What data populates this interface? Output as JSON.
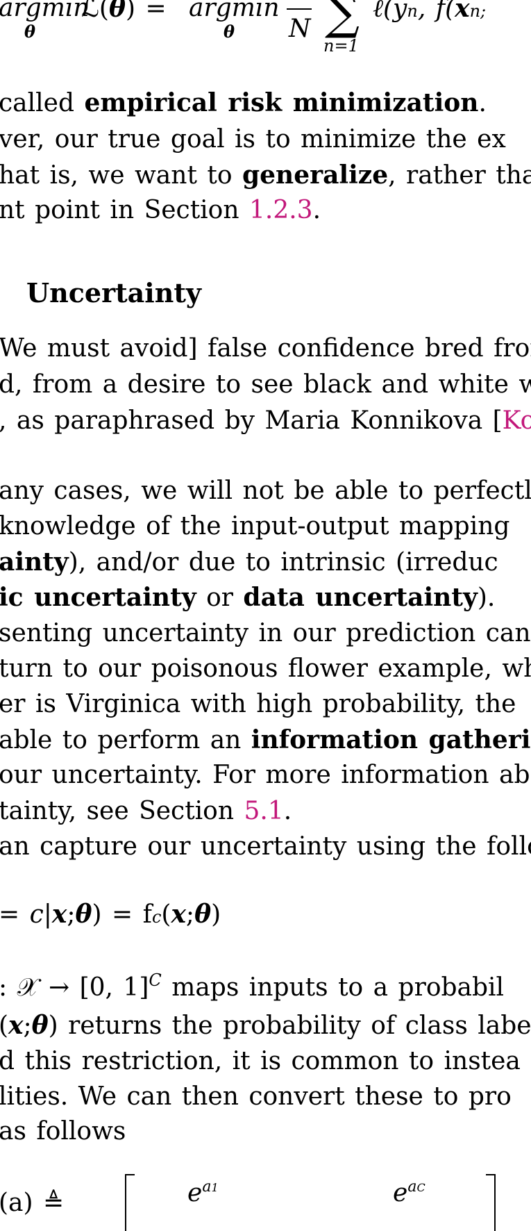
{
  "eq1": {
    "lhs": "argmin",
    "loss": "ℒ(",
    "theta": "θ",
    "eq": ") = ",
    "argmin2": "argmin",
    "N": "N",
    "sum": "∑",
    "n_eq_1": "n=1",
    "ell": "ℓ(y",
    "n": "n",
    "comma": ", f(",
    "x": "x",
    "semi": "n;"
  },
  "p1": {
    "l1_pre": "called ",
    "l1_bold": "empirical risk minimization",
    "l1_post": ".",
    "l2": "ver, our true goal is to minimize the ex",
    "l3_pre": "hat is, we want to ",
    "l3_bold": "generalize",
    "l3_post": ", rather tha",
    "l4_pre": "nt point in Section ",
    "l4_link": "1.2.3",
    "l4_post": "."
  },
  "section": {
    "title": "Uncertainty"
  },
  "quote": {
    "l1": "We must avoid] false confidence bred from",
    "l2": "d, from a desire to see black and white w",
    "l3_pre": ", as paraphrased by Maria Konnikova [",
    "l3_link": "Ko"
  },
  "p2": {
    "l1": "any cases, we will not be able to perfectly",
    "l2": "knowledge of the input-output mapping",
    "l3_bold": "ainty",
    "l3_post": "), and/or due to intrinsic (irreduc",
    "l4_bold1": "ic uncertainty",
    "l4_mid": " or ",
    "l4_bold2": "data uncertainty",
    "l4_post": ").",
    "l5": "senting uncertainty in our prediction can",
    "l6": "turn to our poisonous flower example, wh",
    "l7": "er is Virginica with high probability, the",
    "l8_pre": "able to perform an ",
    "l8_bold": "information gatheri",
    "l9": "our uncertainty. For more information abo",
    "l10_pre": "tainty, see Section ",
    "l10_link": "5.1",
    "l10_post": ".",
    "l11": "an capture our uncertainty using the follo"
  },
  "eq2": {
    "text_pre": "= c|",
    "x": "x",
    "semi": ";",
    "theta": "θ",
    "mid": ") = f",
    "c": "c",
    "open": "(",
    "x2": "x",
    "semi2": ";",
    "theta2": "θ",
    "close": ")"
  },
  "p3": {
    "l1_pre": ": 𝒳 → [0, 1]",
    "l1_sup": "C",
    "l1_post": " maps inputs to a probabil",
    "l2_pre": "(",
    "l2_x": "x",
    "l2_semi": ";",
    "l2_theta": "θ",
    "l2_post": ") returns the probability of class label",
    "l3": "d this restriction, it is common to instea",
    "l4": "lities. We can then convert these to pro",
    "l5": "as follows"
  },
  "eq3": {
    "lhs": "(a) ≜",
    "e1": "e",
    "a1": "a",
    "one": "1",
    "eC": "e",
    "aC": "a",
    "C": "C"
  }
}
